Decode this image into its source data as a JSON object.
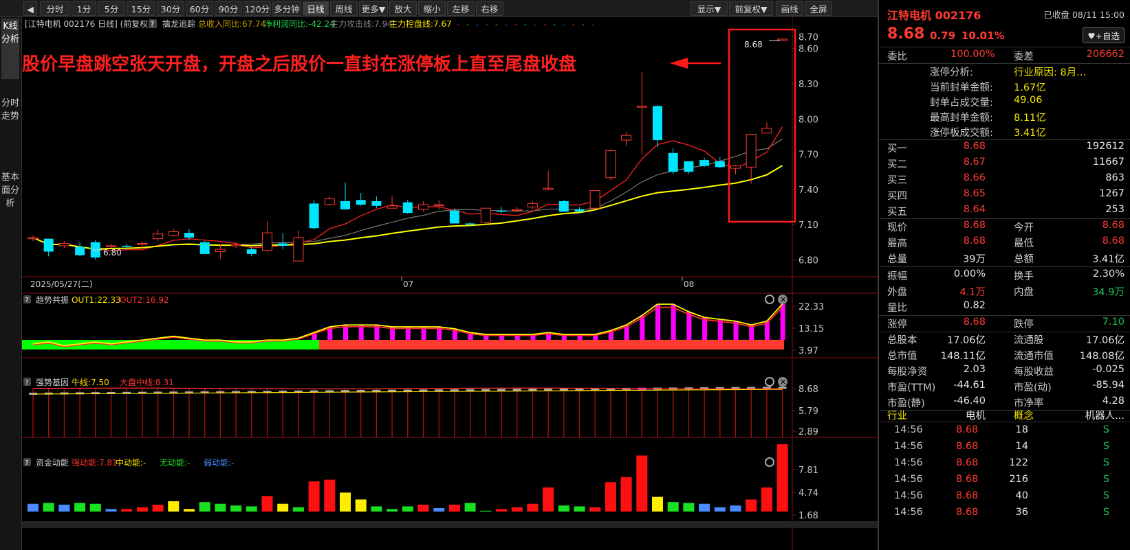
{
  "toolbar": {
    "items": [
      "分时",
      "1分",
      "5分",
      "15分",
      "30分",
      "60分",
      "90分",
      "120分",
      "多分钟",
      "日线",
      "周线",
      "更多▼",
      "放大",
      "缩小",
      "左移",
      "右移"
    ],
    "right": [
      "显示▼",
      "前复权▼",
      "画线",
      "全屏"
    ]
  },
  "nav": {
    "items": [
      {
        "label": "K线分析"
      },
      {
        "label": "分时走势"
      },
      {
        "label": "基本面分析"
      }
    ]
  },
  "main": {
    "header": "[江特电机 002176 日线] (前复权)",
    "indicator": "擒龙追踪",
    "rev": "总收入同比:67.74",
    "profit": "净利润同比:-42.24",
    "attack": "主力攻击线:7.94",
    "control": "主力控盘线:7.67",
    "annotation": "股价早盘跳空张天开盘，开盘之后股价一直封在涨停板上直至尾盘收盘",
    "high_label": "8.68",
    "low_label": "6.80",
    "date_left": "2025/05/27(二)",
    "month1": "07",
    "month2": "08",
    "price_ticks": [
      "8.70",
      "8.60",
      "8.30",
      "8.00",
      "7.70",
      "7.40",
      "7.10",
      "6.80"
    ]
  },
  "panel1": {
    "title": "趋势共振",
    "out1": "OUT1:22.33",
    "out2": "OUT2:16.92",
    "ticks": [
      "22.33",
      "13.15",
      "3.97"
    ]
  },
  "panel2": {
    "title": "强势基因",
    "bull": "牛线:7.50",
    "mid": "大盘中线:8.31",
    "ticks": [
      "8.68",
      "5.79",
      "2.89"
    ]
  },
  "panel3": {
    "title": "资金动能",
    "strong": "强动能:7.81",
    "mid": "中动能:-",
    "none": "无动能:-",
    "weak": "弱动能:-",
    "ticks": [
      "7.81",
      "4.74",
      "1.68"
    ]
  },
  "chart_data": [
    {
      "type": "candlestick",
      "title": "江特电机 002176 日线",
      "candles": [
        [
          6.98,
          7.01,
          6.96,
          6.99
        ],
        [
          6.98,
          6.98,
          6.83,
          6.87
        ],
        [
          6.92,
          6.96,
          6.9,
          6.94
        ],
        [
          6.91,
          6.95,
          6.83,
          6.84
        ],
        [
          6.95,
          6.97,
          6.8,
          6.82
        ],
        [
          6.92,
          6.94,
          6.9,
          6.92
        ],
        [
          6.92,
          6.94,
          6.89,
          6.91
        ],
        [
          6.93,
          6.96,
          6.9,
          6.94
        ],
        [
          6.98,
          7.06,
          6.96,
          7.02
        ],
        [
          7.01,
          7.06,
          7.0,
          7.04
        ],
        [
          7.03,
          7.06,
          6.97,
          6.99
        ],
        [
          6.95,
          6.96,
          6.85,
          6.85
        ],
        [
          6.87,
          6.93,
          6.81,
          6.89
        ],
        [
          6.92,
          6.95,
          6.9,
          6.93
        ],
        [
          6.89,
          6.91,
          6.83,
          6.85
        ],
        [
          6.88,
          7.13,
          6.87,
          7.03
        ],
        [
          6.94,
          7.03,
          6.89,
          6.92
        ],
        [
          6.79,
          7.05,
          6.79,
          6.99
        ],
        [
          7.28,
          7.31,
          7.06,
          7.07
        ],
        [
          7.27,
          7.34,
          7.26,
          7.32
        ],
        [
          7.3,
          7.46,
          7.26,
          7.23
        ],
        [
          7.31,
          7.37,
          7.26,
          7.27
        ],
        [
          7.3,
          7.34,
          7.24,
          7.26
        ],
        [
          7.24,
          7.34,
          7.24,
          7.26
        ],
        [
          7.29,
          7.31,
          7.19,
          7.2
        ],
        [
          7.23,
          7.3,
          7.21,
          7.27
        ],
        [
          7.27,
          7.31,
          7.23,
          7.27
        ],
        [
          7.22,
          7.24,
          7.11,
          7.11
        ],
        [
          7.11,
          7.12,
          7.1,
          7.1
        ],
        [
          7.12,
          7.2,
          7.1,
          7.24
        ],
        [
          7.22,
          7.25,
          7.2,
          7.21
        ],
        [
          7.23,
          7.25,
          7.21,
          7.23
        ],
        [
          7.25,
          7.3,
          7.23,
          7.28
        ],
        [
          7.4,
          7.56,
          7.39,
          7.41
        ],
        [
          7.3,
          7.31,
          7.21,
          7.21
        ],
        [
          7.23,
          7.25,
          7.21,
          7.21
        ],
        [
          7.24,
          7.35,
          7.23,
          7.39
        ],
        [
          7.5,
          7.74,
          7.48,
          7.73
        ],
        [
          7.82,
          7.89,
          7.77,
          7.86
        ],
        [
          8.1,
          8.4,
          7.7,
          8.11
        ],
        [
          8.11,
          8.12,
          7.76,
          7.82
        ],
        [
          7.71,
          7.75,
          7.53,
          7.55
        ],
        [
          7.64,
          7.6,
          7.53,
          7.55
        ],
        [
          7.65,
          7.67,
          7.59,
          7.6
        ],
        [
          7.64,
          7.68,
          7.58,
          7.59
        ],
        [
          7.58,
          7.61,
          7.53,
          7.6
        ],
        [
          7.59,
          7.85,
          7.45,
          7.87
        ],
        [
          7.88,
          7.97,
          7.88,
          7.92
        ],
        [
          8.68,
          8.68,
          8.68,
          8.68
        ]
      ],
      "ma_attack_ends": [
        6.96,
        7.94
      ],
      "ma_control_ends": [
        7.1,
        7.67
      ],
      "ylim": [
        6.75,
        8.75
      ]
    },
    {
      "type": "bar",
      "title": "趋势共振",
      "out1": 22.33,
      "out2": 16.92
    },
    {
      "type": "bar",
      "title": "强势基因",
      "bull": 7.5,
      "mid": 8.31
    },
    {
      "type": "bar",
      "title": "资金动能",
      "strong": 7.81,
      "values": [
        0.9,
        1.0,
        0.8,
        1.0,
        0.9,
        0.3,
        0.3,
        0.5,
        0.8,
        1.2,
        0.3,
        1.1,
        0.9,
        0.7,
        0.6,
        1.8,
        0.9,
        0.5,
        3.5,
        3.7,
        2.2,
        1.4,
        0.6,
        0.3,
        0.6,
        0.8,
        0.4,
        0.8,
        1.0,
        0.1,
        0.3,
        0.5,
        0.9,
        2.8,
        0.7,
        0.6,
        0.5,
        3.4,
        4.0,
        6.5,
        1.7,
        1.1,
        1.0,
        0.9,
        0.5,
        0.7,
        1.4,
        2.8,
        7.81
      ],
      "colors": [
        "b",
        "g",
        "b",
        "g",
        "g",
        "b",
        "r",
        "r",
        "r",
        "y",
        "y",
        "g",
        "g",
        "g",
        "g",
        "r",
        "y",
        "g",
        "r",
        "r",
        "y",
        "y",
        "g",
        "g",
        "g",
        "r",
        "b",
        "r",
        "g",
        "g",
        "r",
        "r",
        "r",
        "r",
        "g",
        "g",
        "r",
        "r",
        "r",
        "r",
        "y",
        "g",
        "g",
        "b",
        "b",
        "b",
        "r",
        "r",
        "r"
      ]
    }
  ],
  "quote": {
    "name": "江特电机 002176",
    "status": "已收盘 08/11 15:00",
    "price": "8.68",
    "change": "0.79",
    "pct": "10.01%",
    "watch": "♥+自选",
    "wb_label": "委比",
    "wb": "100.00%",
    "wc_label": "委差",
    "wc": "206662",
    "limit": [
      {
        "k": "涨停分析:",
        "v": "行业原因: 8月..."
      },
      {
        "k": "当前封单金额:",
        "v": "1.67亿"
      },
      {
        "k": "封单占成交量:",
        "v": "49.06"
      },
      {
        "k": "最高封单金额:",
        "v": "8.11亿"
      },
      {
        "k": "涨停板成交额:",
        "v": "3.41亿"
      }
    ],
    "bids": [
      {
        "k": "买一",
        "p": "8.68",
        "v": "192612"
      },
      {
        "k": "买二",
        "p": "8.67",
        "v": "11667"
      },
      {
        "k": "买三",
        "p": "8.66",
        "v": "863"
      },
      {
        "k": "买四",
        "p": "8.65",
        "v": "1267"
      },
      {
        "k": "买五",
        "p": "8.64",
        "v": "253"
      }
    ],
    "stats": [
      {
        "l1": "现价",
        "v1": "8.68",
        "c1": "red",
        "l2": "今开",
        "v2": "8.68",
        "c2": "red"
      },
      {
        "l1": "最高",
        "v1": "8.68",
        "c1": "red",
        "l2": "最低",
        "v2": "8.68",
        "c2": "red"
      },
      {
        "l1": "总量",
        "v1": "39万",
        "c1": "white",
        "l2": "总额",
        "v2": "3.41亿",
        "c2": "white"
      },
      {
        "l1": "振幅",
        "v1": "0.00%",
        "c1": "white",
        "l2": "换手",
        "v2": "2.30%",
        "c2": "white"
      },
      {
        "l1": "外盘",
        "v1": "4.1万",
        "c1": "red",
        "l2": "内盘",
        "v2": "34.9万",
        "c2": "green"
      },
      {
        "l1": "量比",
        "v1": "0.82",
        "c1": "white",
        "l2": "",
        "v2": "",
        "c2": "white"
      },
      {
        "l1": "涨停",
        "v1": "8.68",
        "c1": "red",
        "l2": "跌停",
        "v2": "7.10",
        "c2": "green"
      },
      {
        "l1": "总股本",
        "v1": "17.06亿",
        "c1": "white",
        "l2": "流通股",
        "v2": "17.06亿",
        "c2": "white"
      },
      {
        "l1": "总市值",
        "v1": "148.11亿",
        "c1": "white",
        "l2": "流通市值",
        "v2": "148.08亿",
        "c2": "white"
      },
      {
        "l1": "每股净资",
        "v1": "2.03",
        "c1": "white",
        "l2": "每股收益",
        "v2": "-0.025",
        "c2": "white"
      },
      {
        "l1": "市盈(TTM)",
        "v1": "-44.61",
        "c1": "white",
        "l2": "市盈(动)",
        "v2": "-85.94",
        "c2": "white"
      },
      {
        "l1": "市盈(静)",
        "v1": "-46.40",
        "c1": "white",
        "l2": "市净率",
        "v2": "4.28",
        "c2": "white"
      }
    ],
    "industry": {
      "k": "行业",
      "v": "电机",
      "k2": "概念",
      "v2": "机器人..."
    },
    "ticks": [
      {
        "t": "14:56",
        "p": "8.68",
        "v": "18",
        "s": "S"
      },
      {
        "t": "14:56",
        "p": "8.68",
        "v": "14",
        "s": "S"
      },
      {
        "t": "14:56",
        "p": "8.68",
        "v": "122",
        "s": "S"
      },
      {
        "t": "14:56",
        "p": "8.68",
        "v": "216",
        "s": "S"
      },
      {
        "t": "14:56",
        "p": "8.68",
        "v": "40",
        "s": "S"
      },
      {
        "t": "14:56",
        "p": "8.68",
        "v": "36",
        "s": "S"
      }
    ]
  },
  "colors": {
    "up": "#ff3b30",
    "down": "#00e5ff",
    "ma1": "#ff2020",
    "ma2": "#ffff00",
    "magenta": "#ff00ff",
    "green": "#00ff00"
  }
}
